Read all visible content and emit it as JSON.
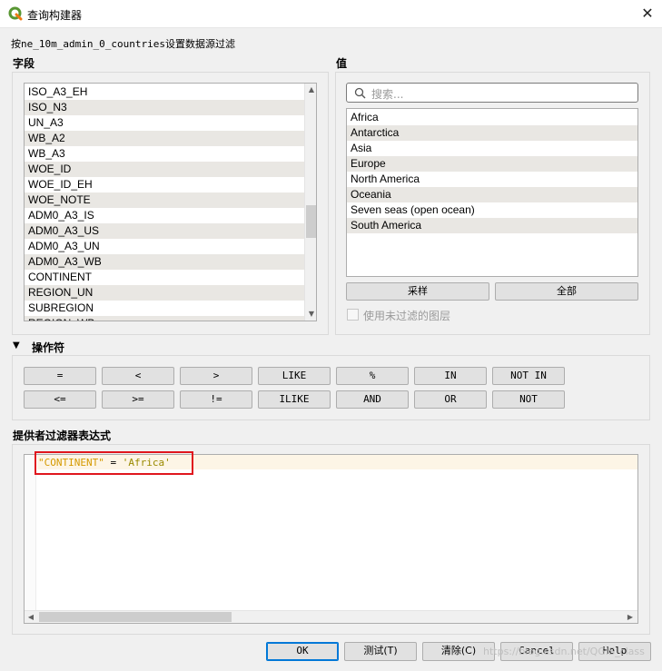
{
  "window": {
    "title": "查询构建器",
    "close_glyph": "✕",
    "subtitle": "按ne_10m_admin_0_countries设置数据源过滤"
  },
  "fields": {
    "label": "字段",
    "items": [
      "ISO_A3_EH",
      "ISO_N3",
      "UN_A3",
      "WB_A2",
      "WB_A3",
      "WOE_ID",
      "WOE_ID_EH",
      "WOE_NOTE",
      "ADM0_A3_IS",
      "ADM0_A3_US",
      "ADM0_A3_UN",
      "ADM0_A3_WB",
      "CONTINENT",
      "REGION_UN",
      "SUBREGION",
      "REGION_WB"
    ]
  },
  "values": {
    "label": "值",
    "search_placeholder": "搜索...",
    "items": [
      "Africa",
      "Antarctica",
      "Asia",
      "Europe",
      "North America",
      "Oceania",
      "Seven seas (open ocean)",
      "South America"
    ],
    "sample_button": "采样",
    "all_button": "全部",
    "use_unfiltered_label": "使用未过滤的图层"
  },
  "operators": {
    "label": "操作符",
    "row1": [
      "=",
      "<",
      ">",
      "LIKE",
      "%",
      "IN",
      "NOT IN"
    ],
    "row2": [
      "<=",
      ">=",
      "!=",
      "ILIKE",
      "AND",
      "OR",
      "NOT"
    ]
  },
  "expression": {
    "label": "提供者过滤器表达式",
    "field_token": "\"CONTINENT\"",
    "operator_token": " = ",
    "value_token": "'Africa'"
  },
  "footer": {
    "ok": "OK",
    "test": "测试(T)",
    "clear": "清除(C)",
    "cancel": "Cancel",
    "help": "Help",
    "watermark": "https://blog.csdn.net/QGIS_class"
  },
  "colors": {
    "field_token": "#d59a00",
    "value_token": "#9a8a00",
    "highlight_box": "#e0161e",
    "accent": "#0078d7"
  }
}
